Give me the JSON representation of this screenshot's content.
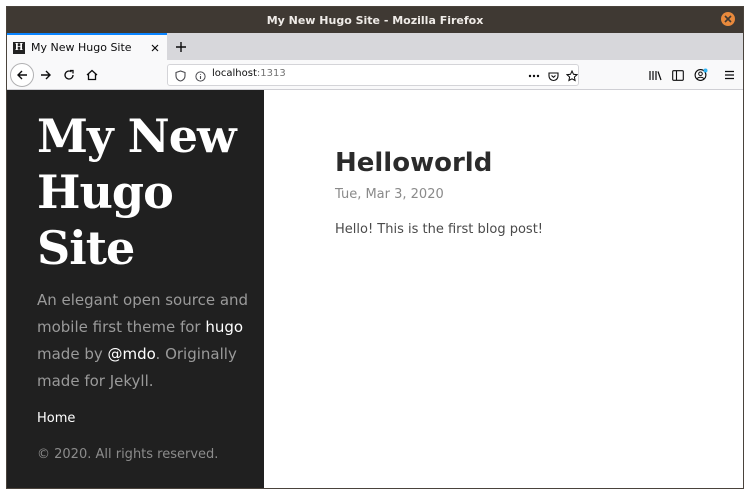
{
  "window": {
    "title": "My New Hugo Site - Mozilla Firefox"
  },
  "tab": {
    "favicon_letter": "H",
    "title": "My New Hugo Site"
  },
  "urlbar": {
    "host": "localhost",
    "port": ":1313"
  },
  "icons": {
    "back": "back-arrow-icon",
    "forward": "forward-arrow-icon",
    "reload": "reload-icon",
    "home": "home-icon",
    "shield": "tracking-shield-icon",
    "info": "site-info-icon",
    "page_actions": "more-actions-icon",
    "pocket": "pocket-icon",
    "bookmark": "bookmark-star-icon",
    "library": "library-icon",
    "sidebar": "sidebar-icon",
    "account": "account-icon",
    "menu": "hamburger-menu-icon"
  },
  "sidebar": {
    "site_title": "My New Hugo Site",
    "lead_1": "An elegant open source and mobile first theme for ",
    "lead_link_1": "hugo",
    "lead_2": " made by ",
    "lead_link_2": "@mdo",
    "lead_3": ". Originally made for Jekyll.",
    "nav_home": "Home",
    "copyright": "© 2020. All rights reserved."
  },
  "post": {
    "title": "Helloworld",
    "date": "Tue, Mar 3, 2020",
    "body": "Hello! This is the first blog post!"
  },
  "colors": {
    "sidebar_bg": "#202020",
    "titlebar_bg": "#3f3933",
    "accent": "#0a84ff",
    "close_button": "#e8893c"
  }
}
